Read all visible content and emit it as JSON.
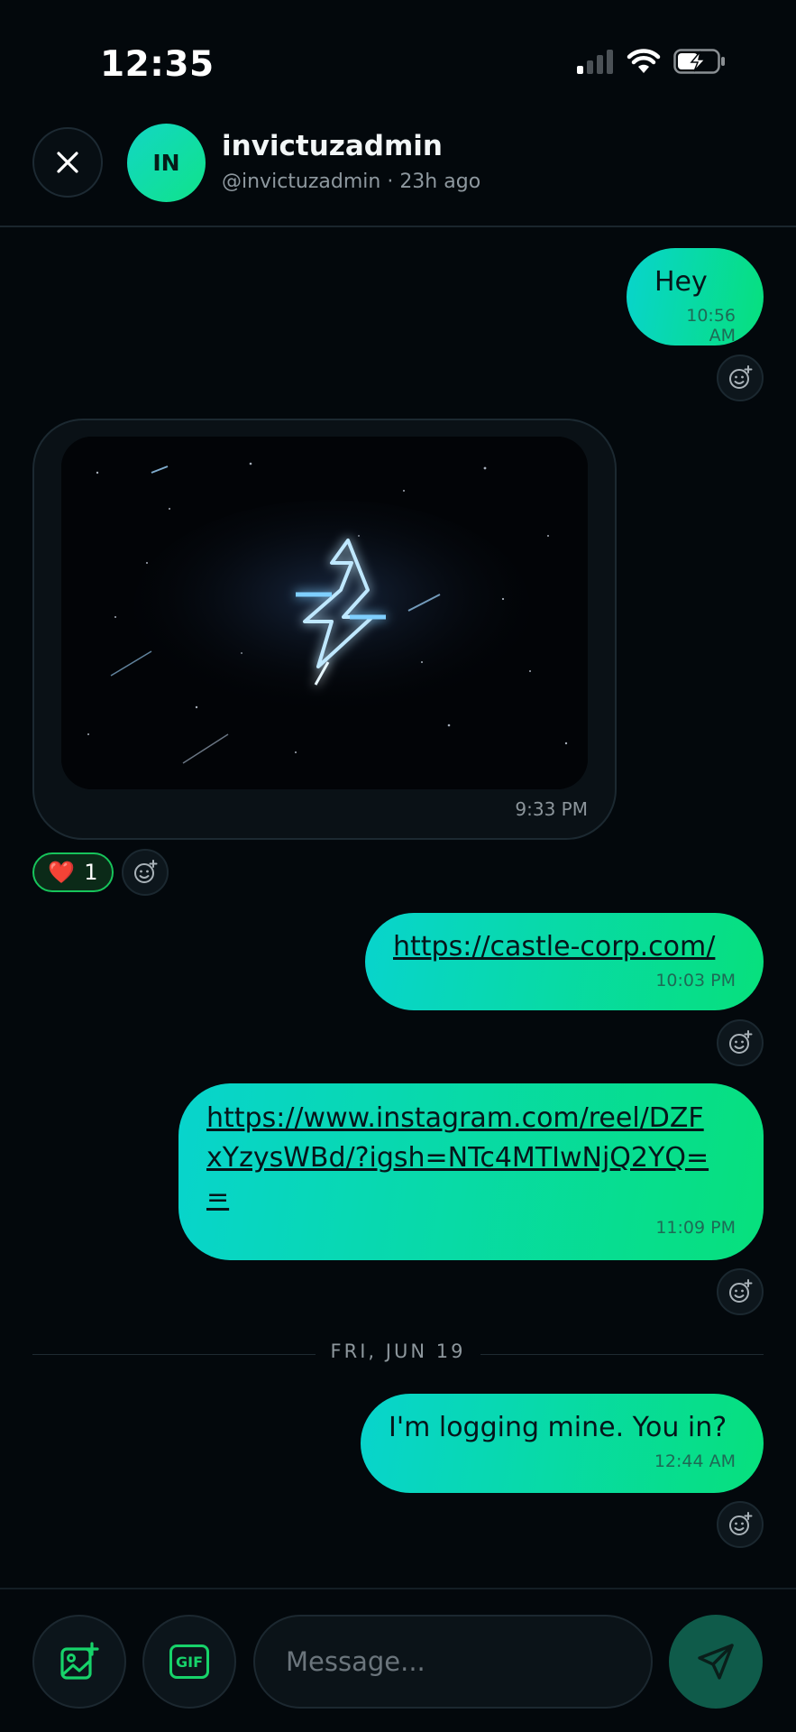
{
  "status_bar": {
    "time": "12:35",
    "icons": [
      "signal-icon",
      "wifi-icon",
      "battery-charging-icon"
    ]
  },
  "header": {
    "close_icon": "close-icon",
    "avatar_initials": "IN",
    "name": "invictuzadmin",
    "subtitle": "@invictuzadmin · 23h ago"
  },
  "messages": [
    {
      "type": "text",
      "direction": "outgoing",
      "text": "Hey",
      "time": "10:56 AM"
    },
    {
      "type": "image",
      "direction": "incoming",
      "time": "9:33 PM",
      "reactions": [
        {
          "emoji": "❤️",
          "count": "1"
        }
      ]
    },
    {
      "type": "link",
      "direction": "outgoing",
      "text": "https://castle-corp.com/",
      "time": "10:03 PM"
    },
    {
      "type": "link",
      "direction": "outgoing",
      "text": "https://www.instagram.com/reel/DZF\nxYzysWBd/?igsh=NTc4MTIwNjQ2YQ=\n=",
      "time": "11:09 PM"
    },
    {
      "type": "divider",
      "label": "FRI, JUN 19"
    },
    {
      "type": "text",
      "direction": "outgoing",
      "text": "I'm logging mine. You in?",
      "time": "12:44 AM"
    }
  ],
  "composer": {
    "image_button_icon": "add-image-icon",
    "gif_label": "GIF",
    "placeholder": "Message...",
    "send_icon": "send-icon"
  },
  "colors": {
    "background": "#03080c",
    "bubble_gradient_start": "#08d4cd",
    "bubble_gradient_end": "#07e07c",
    "accent_green": "#17c45b"
  }
}
